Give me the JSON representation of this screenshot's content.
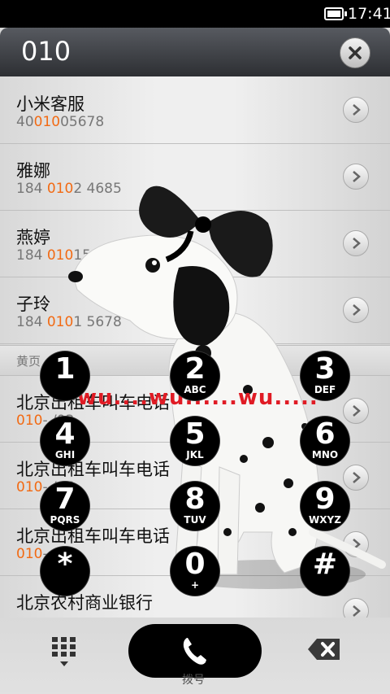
{
  "status": {
    "time": "17:41"
  },
  "search": {
    "query": "010"
  },
  "contacts": [
    {
      "name": "小米客服",
      "num_pre": "40",
      "num_hl": "010",
      "num_post": "05678"
    },
    {
      "name": "雅娜",
      "num_pre": "184 ",
      "num_hl": "010",
      "num_post": "2 4685"
    },
    {
      "name": "燕婷",
      "num_pre": "184 ",
      "num_hl": "010",
      "num_post": "15689"
    },
    {
      "name": "子玲",
      "num_pre": "184 ",
      "num_hl": "010",
      "num_post": "1 5678"
    }
  ],
  "section_title": "黄页",
  "yellow_pages": [
    {
      "name": "北京出租车叫车电话",
      "num_hl": "010",
      "num_post": "-  /03"
    },
    {
      "name": "北京出租车叫车电话",
      "num_hl": "010",
      "num_post": "-  /06"
    },
    {
      "name": "北京出租车叫车电话",
      "num_hl": "010",
      "num_post": "-  /09"
    },
    {
      "name": "北京农村商业银行",
      "num_hl": "",
      "num_post": ""
    }
  ],
  "overlay_text": "wu....wu......wu.....",
  "keypad": [
    {
      "digit": "1",
      "letters": ""
    },
    {
      "digit": "2",
      "letters": "ABC"
    },
    {
      "digit": "3",
      "letters": "DEF"
    },
    {
      "digit": "4",
      "letters": "GHI"
    },
    {
      "digit": "5",
      "letters": "JKL"
    },
    {
      "digit": "6",
      "letters": "MNO"
    },
    {
      "digit": "7",
      "letters": "PQRS"
    },
    {
      "digit": "8",
      "letters": "TUV"
    },
    {
      "digit": "9",
      "letters": "WXYZ"
    },
    {
      "digit": "*",
      "letters": ""
    },
    {
      "digit": "0",
      "letters": "+"
    },
    {
      "digit": "#",
      "letters": ""
    }
  ],
  "call_label": "拨号",
  "colors": {
    "highlight": "#f26a13",
    "header": "#3a3c40"
  },
  "icons": [
    "battery-icon",
    "clear-icon",
    "chevron-right-icon",
    "dialpad-icon",
    "phone-icon",
    "backspace-icon"
  ]
}
